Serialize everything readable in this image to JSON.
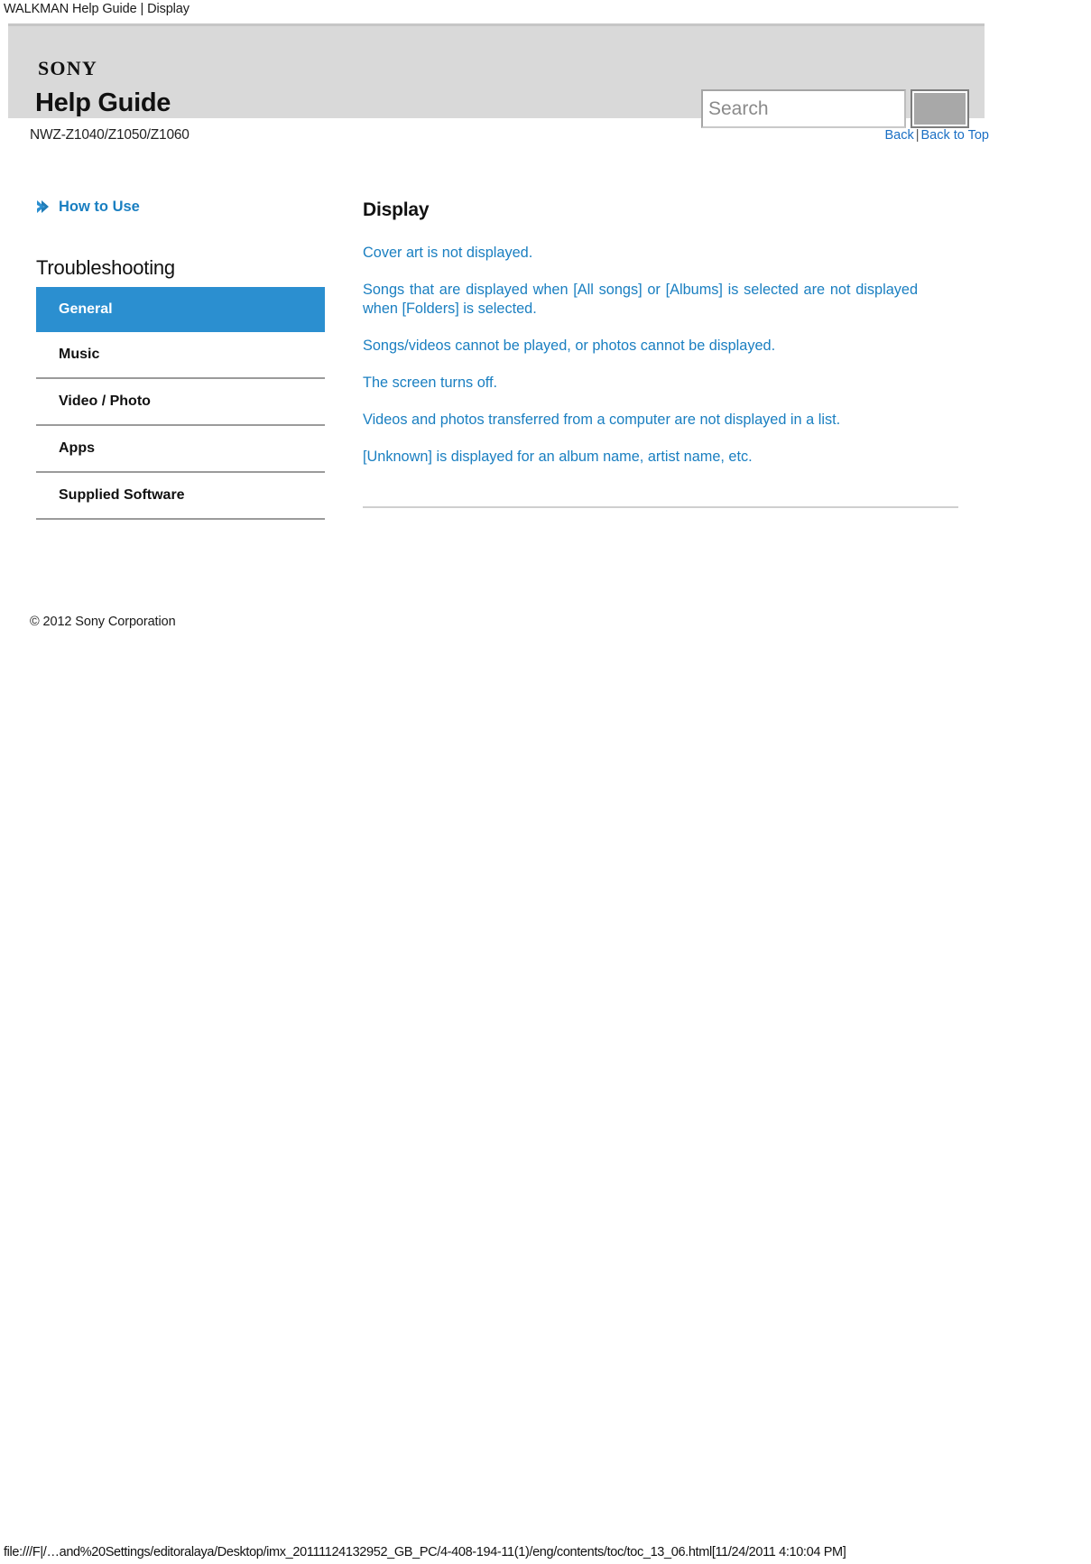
{
  "window": {
    "page_title": "WALKMAN Help Guide | Display",
    "footer_url": "file:///F|/…and%20Settings/editoralaya/Desktop/imx_20111124132952_GB_PC/4-408-194-11(1)/eng/contents/toc/toc_13_06.html[11/24/2011 4:10:04 PM]"
  },
  "header": {
    "brand": "SONY",
    "title": "Help Guide",
    "search": {
      "placeholder": "Search",
      "value": "",
      "button_label": ""
    }
  },
  "subheader": {
    "model": "NWZ-Z1040/Z1050/Z1060",
    "back_label": "Back",
    "separator": "|",
    "back_to_top_label": "Back to Top"
  },
  "sidebar": {
    "how_to_use": "How to Use",
    "section_heading": "Troubleshooting",
    "items": [
      {
        "label": "General",
        "active": true
      },
      {
        "label": "Music",
        "active": false
      },
      {
        "label": "Video / Photo",
        "active": false
      },
      {
        "label": "Apps",
        "active": false
      },
      {
        "label": "Supplied Software",
        "active": false
      }
    ],
    "copyright": "© 2012 Sony Corporation"
  },
  "main": {
    "heading": "Display",
    "topics": [
      "Cover art is not displayed.",
      "Songs that are displayed when [All songs] or [Albums] is selected are not displayed when [Folders] is selected.",
      "Songs/videos cannot be played, or photos cannot be displayed.",
      "The screen turns off.",
      "Videos and photos transferred from a computer are not displayed in a list.",
      "[Unknown] is displayed for an album name, artist name, etc."
    ]
  },
  "colors": {
    "accent_blue": "#1a7fc1",
    "active_blue": "#2b8fd0",
    "header_gray": "#d9d9d9",
    "link_blue": "#1a6fc4"
  }
}
